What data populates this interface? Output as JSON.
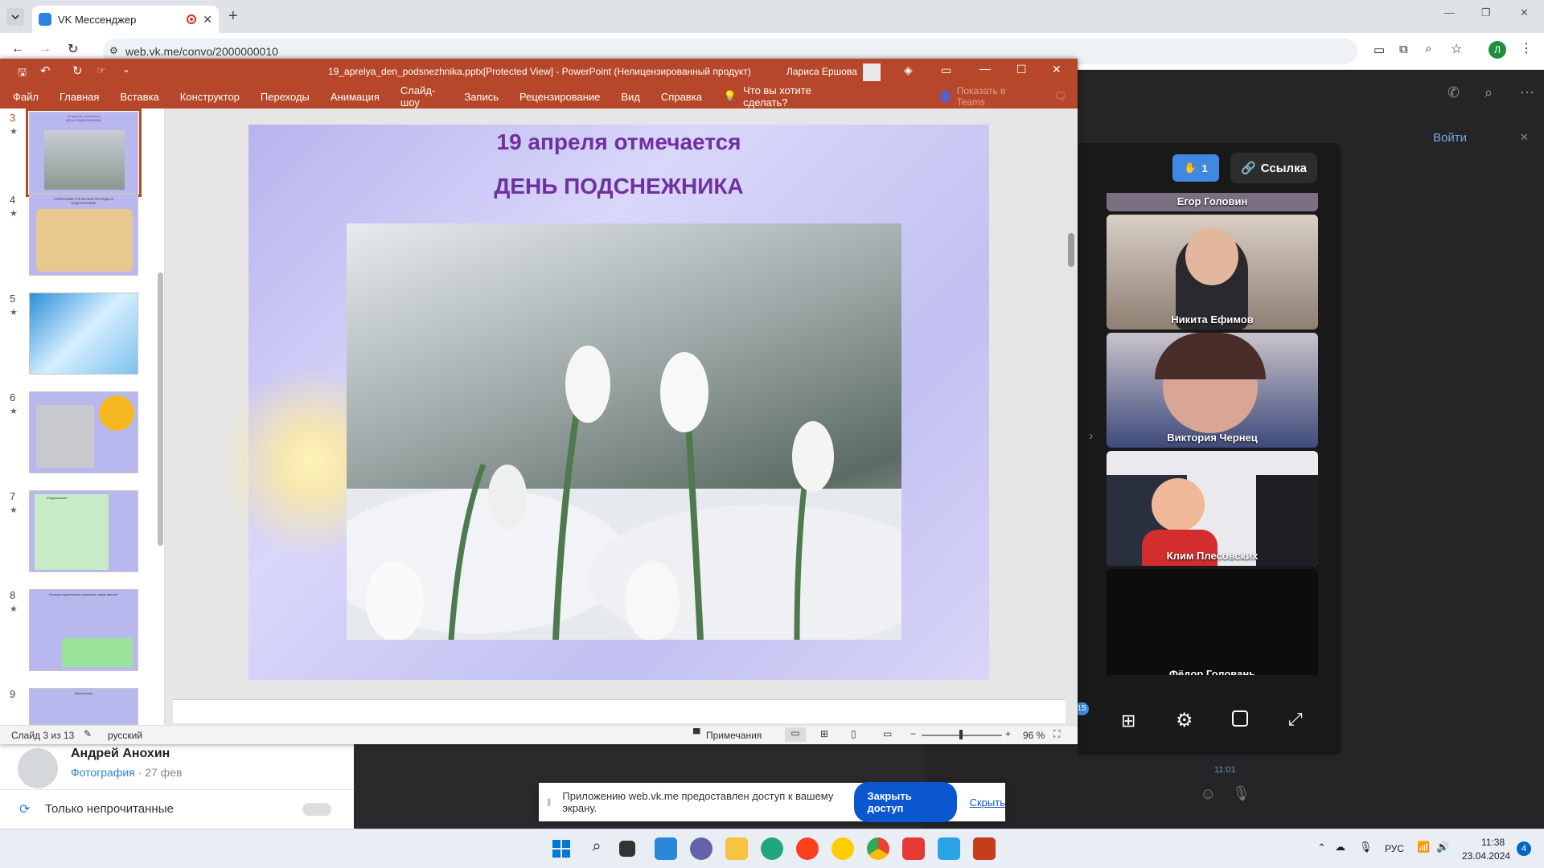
{
  "browser": {
    "tab_title": "VK Мессенджер",
    "url": "web.vk.me/convo/2000000010",
    "profile_letter": "Л"
  },
  "powerpoint": {
    "title": "19_aprelya_den_podsnezhnika.pptx[Protected View]  -  PowerPoint (Нелицензированный продукт)",
    "user": "Лариса Ершова",
    "menu": [
      "Файл",
      "Главная",
      "Вставка",
      "Конструктор",
      "Переходы",
      "Анимация",
      "Слайд-шоу",
      "Запись",
      "Рецензирование",
      "Вид",
      "Справка"
    ],
    "tell_me": "Что вы хотите сделать?",
    "teams": "Показать в Teams",
    "slide_numbers": [
      "3",
      "4",
      "5",
      "6",
      "7",
      "8",
      "9"
    ],
    "slide": {
      "line1": "19 апреля отмечается",
      "line2": "ДЕНЬ ПОДСНЕЖНИКА"
    },
    "status": {
      "slide_of": "Слайд 3 из 13",
      "language": "русский",
      "notes": "Примечания",
      "zoom": "96 %"
    },
    "thumbs_text": {
      "t3_title": "19 апреля отмечается",
      "t3_sub": "ДЕНЬ ПОДСНЕЖНИКА",
      "t4_title": "СТАРИННЫЕ ГРЕЧЕСКИЕ ЛЕГЕНДЫ О ПОДСНЕЖНИКЕ",
      "t7_title": "«Подснежник»",
      "t8_title": "Почему подснежники называют таким цветок?",
      "t9_title": "Заключение"
    }
  },
  "vk": {
    "link_button": "Ссылка",
    "raised_hands": "1",
    "login": "Войти",
    "participants": [
      "Егор Головин",
      "Никита Ефимов",
      "Виктория Чернец",
      "Клим Плесовских",
      "Фёдор Головань"
    ],
    "badge_count": "15",
    "chat_name": "Андрей Анохин",
    "chat_snippet": "Фотография",
    "chat_date": "· 27 фев",
    "unread_only": "Только непрочитанные",
    "msg_time": "11:01"
  },
  "share_bar": {
    "message": "Приложению web.vk.me предоставлен доступ к вашему экрану.",
    "stop_button": "Закрыть доступ",
    "hide_link": "Скрыть"
  },
  "taskbar": {
    "lang": "РУС",
    "time": "11:38",
    "date": "23.04.2024",
    "notif": "4"
  },
  "colors": {
    "pp_accent": "#b7472a",
    "slide_title": "#7030a0",
    "vk_blue": "#2d81e0"
  }
}
